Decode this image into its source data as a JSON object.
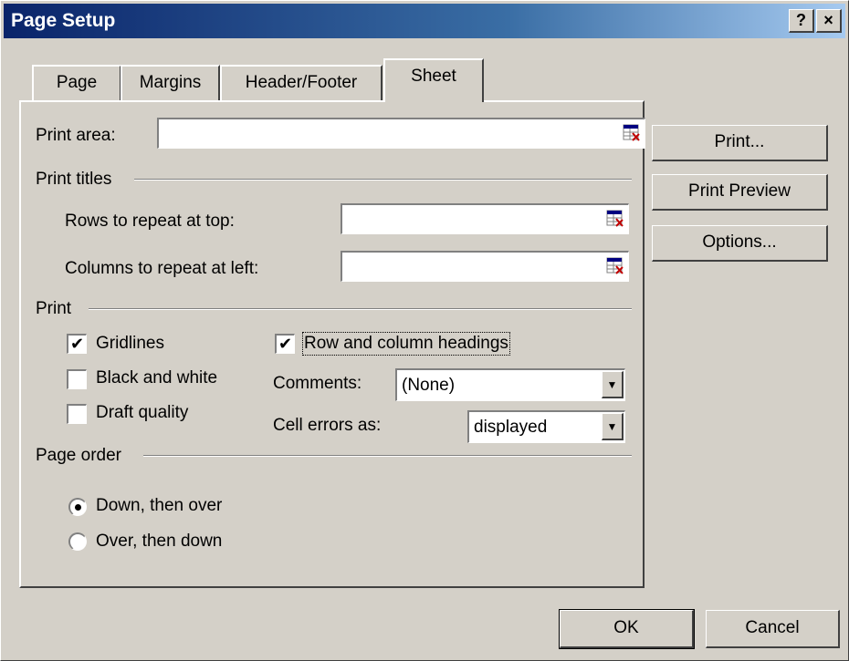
{
  "window": {
    "title": "Page Setup",
    "help_label": "?",
    "close_label": "×"
  },
  "tabs": [
    {
      "label": "Page",
      "active": false
    },
    {
      "label": "Margins",
      "active": false
    },
    {
      "label": "Header/Footer",
      "active": false
    },
    {
      "label": "Sheet",
      "active": true
    }
  ],
  "sheet": {
    "print_area": {
      "label": "Print area:",
      "value": ""
    },
    "print_titles": {
      "label": "Print titles",
      "rows_label": "Rows to repeat at top:",
      "rows_value": "",
      "cols_label": "Columns to repeat at left:",
      "cols_value": ""
    },
    "print": {
      "label": "Print",
      "gridlines": {
        "label": "Gridlines",
        "checked": true
      },
      "black_white": {
        "label": "Black and white",
        "checked": false
      },
      "draft_quality": {
        "label": "Draft quality",
        "checked": false
      },
      "row_col_headings": {
        "label": "Row and column headings",
        "checked": true
      },
      "comments": {
        "label": "Comments:",
        "value": "(None)"
      },
      "cell_errors": {
        "label": "Cell errors as:",
        "value": "displayed"
      }
    },
    "page_order": {
      "label": "Page order",
      "down_then_over": {
        "label": "Down, then over",
        "selected": true
      },
      "over_then_down": {
        "label": "Over, then down",
        "selected": false
      }
    }
  },
  "side_buttons": {
    "print": "Print...",
    "print_preview": "Print Preview",
    "options": "Options..."
  },
  "footer": {
    "ok": "OK",
    "cancel": "Cancel"
  },
  "colors": {
    "title_gradient_start": "#0a246a",
    "title_gradient_end": "#a6caf0",
    "dialog_face": "#d4d0c8",
    "arrow_teal": "#1f8a8a"
  }
}
